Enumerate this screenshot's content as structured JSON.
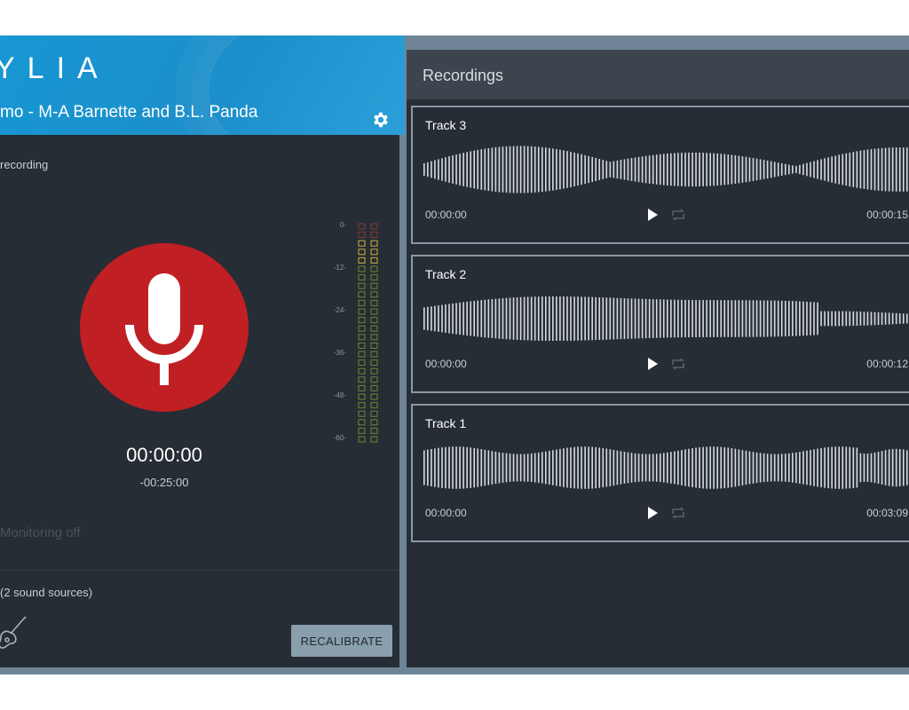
{
  "app": {
    "logo_text": "YLIA"
  },
  "session": {
    "title": "mo - M-A Barnette and B.L. Panda"
  },
  "recorder": {
    "status": "recording",
    "timer": "00:00:00",
    "remaining": "-00:25:00",
    "monitoring": "Monitoring off",
    "sources": "(2 sound sources)",
    "recalibrate_label": "RECALIBRATE",
    "meter_labels": [
      "0-",
      "-12-",
      "-24-",
      "-36-",
      "-48-",
      "-60-"
    ]
  },
  "recordings": {
    "title": "Recordings",
    "tracks": [
      {
        "name": "Track 3",
        "start": "00:00:00",
        "end": "00:00:15"
      },
      {
        "name": "Track 2",
        "start": "00:00:00",
        "end": "00:00:12"
      },
      {
        "name": "Track 1",
        "start": "00:00:00",
        "end": "00:03:09"
      }
    ]
  },
  "colors": {
    "header_blue": "#1797d3",
    "record_red": "#c01f24",
    "panel_bg": "#262d35",
    "meter_green": "#6c8a2e",
    "meter_yellow": "#c9b23a",
    "meter_red": "#8a3a38"
  },
  "icons": {
    "settings": "gear-icon",
    "record": "microphone-icon",
    "instrument": "guitar-icon",
    "play": "play-icon",
    "loop": "loop-icon"
  }
}
